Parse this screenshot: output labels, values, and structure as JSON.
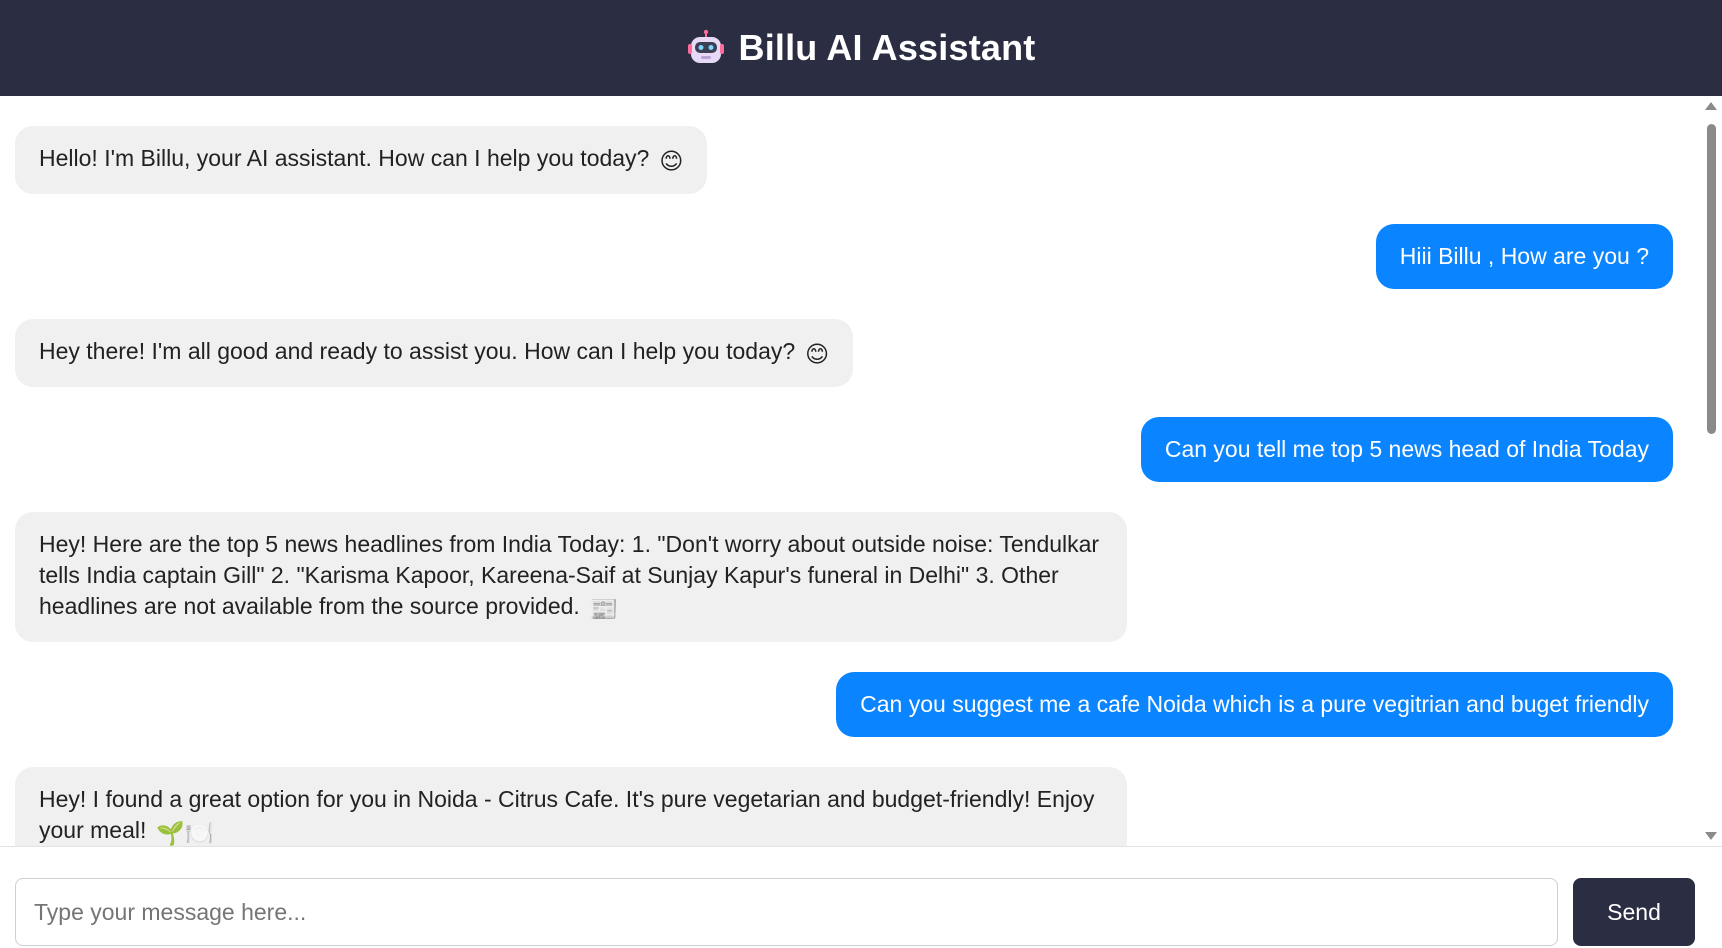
{
  "app": {
    "title": "Billu AI Assistant",
    "header_icon": "robot-icon",
    "colors": {
      "header_bg": "#2b2d42",
      "user_bubble": "#0a84ff",
      "bot_bubble": "#f0f0f0",
      "send_button": "#2b2d42"
    }
  },
  "messages": [
    {
      "role": "bot",
      "text": "Hello! I'm Billu, your AI assistant. How can I help you today?",
      "emoji": "😊"
    },
    {
      "role": "user",
      "text": "Hiii Billu , How are you ?",
      "emoji": ""
    },
    {
      "role": "bot",
      "text": "Hey there! I'm all good and ready to assist you. How can I help you today?",
      "emoji": "😊"
    },
    {
      "role": "user",
      "text": "Can you tell me top 5 news head of India Today",
      "emoji": ""
    },
    {
      "role": "bot",
      "text": "Hey! Here are the top 5 news headlines from India Today: 1. \"Don't worry about outside noise: Tendulkar tells India captain Gill\" 2. \"Karisma Kapoor, Kareena-Saif at Sunjay Kapur's funeral in Delhi\" 3. Other headlines are not available from the source provided.",
      "emoji": "📰"
    },
    {
      "role": "user",
      "text": "Can you suggest me a cafe Noida which is a pure vegitrian and buget friendly",
      "emoji": ""
    },
    {
      "role": "bot",
      "text": "Hey! I found a great option for you in Noida - Citrus Cafe. It's pure vegetarian and budget-friendly! Enjoy your meal!",
      "emoji": "🌱🍽️"
    }
  ],
  "composer": {
    "placeholder": "Type your message here...",
    "value": "",
    "send_label": "Send"
  }
}
